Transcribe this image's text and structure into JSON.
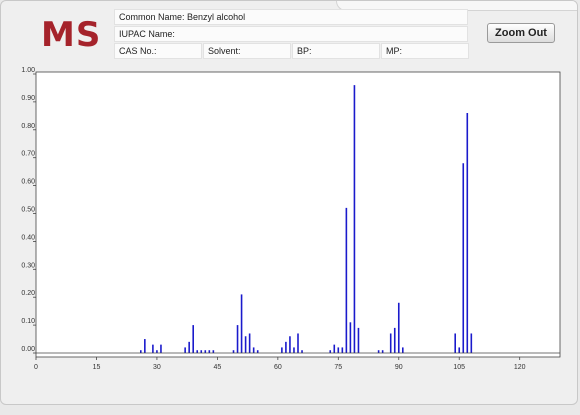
{
  "header": {
    "logo": "MS",
    "common_name_label": "Common Name:",
    "common_name_value": "Benzyl alcohol",
    "iupac_label": "IUPAC Name:",
    "iupac_value": "",
    "cas_label": "CAS No.:",
    "cas_value": "",
    "solvent_label": "Solvent:",
    "solvent_value": "",
    "bp_label": "BP:",
    "bp_value": "",
    "mp_label": "MP:",
    "mp_value": "",
    "zoom_out_label": "Zoom Out"
  },
  "colors": {
    "logo": "#a5232b",
    "bars": "#1a1acc",
    "axis": "#444444"
  },
  "chart_data": {
    "type": "bar",
    "title": "",
    "xlabel": "",
    "ylabel": "",
    "xlim": [
      0,
      130
    ],
    "ylim": [
      0,
      1.0
    ],
    "grid": false,
    "x_ticks": [
      0,
      15,
      30,
      45,
      60,
      75,
      90,
      105,
      120
    ],
    "y_ticks": [
      0.0,
      0.1,
      0.2,
      0.3,
      0.4,
      0.5,
      0.6,
      0.7,
      0.8,
      0.9,
      1.0
    ],
    "x_tick_labels": [
      "0",
      "15",
      "30",
      "45",
      "60",
      "75",
      "90",
      "105",
      "120"
    ],
    "y_tick_labels": [
      "0.00",
      "0.10",
      "0.20",
      "0.30",
      "0.40",
      "0.50",
      "0.60",
      "0.70",
      "0.80",
      "0.90",
      "1.00"
    ],
    "series": [
      {
        "x": [
          26,
          27,
          29,
          30,
          31,
          37,
          38,
          39,
          40,
          41,
          42,
          43,
          44,
          49,
          50,
          51,
          52,
          53,
          54,
          55,
          61,
          62,
          63,
          64,
          65,
          66,
          73,
          74,
          75,
          76,
          77,
          78,
          79,
          80,
          85,
          86,
          88,
          89,
          90,
          91,
          104,
          105,
          106,
          107,
          108
        ],
        "values": [
          0.01,
          0.05,
          0.03,
          0.01,
          0.03,
          0.02,
          0.04,
          0.1,
          0.01,
          0.01,
          0.01,
          0.01,
          0.01,
          0.01,
          0.1,
          0.21,
          0.06,
          0.07,
          0.02,
          0.01,
          0.02,
          0.04,
          0.06,
          0.02,
          0.07,
          0.01,
          0.01,
          0.03,
          0.02,
          0.02,
          0.52,
          0.11,
          0.96,
          0.09,
          0.01,
          0.01,
          0.07,
          0.09,
          0.18,
          0.02,
          0.07,
          0.02,
          0.68,
          0.86,
          0.07
        ]
      }
    ]
  }
}
